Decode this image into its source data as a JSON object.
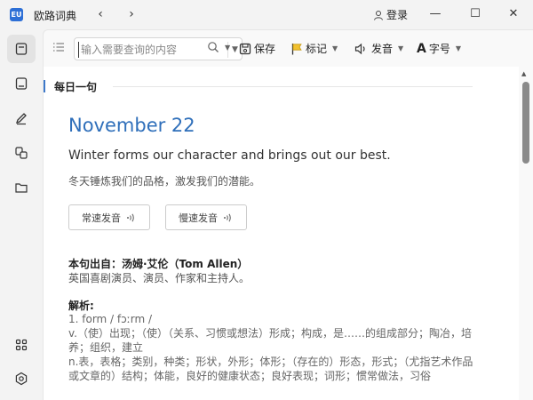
{
  "app": {
    "title": "欧路词典",
    "login": "登录"
  },
  "toolbar": {
    "search_placeholder": "输入需要查询的内容",
    "save": "保存",
    "mark": "标记",
    "speak": "发音",
    "fontsize": "字号"
  },
  "sidebar": {
    "items": [
      {
        "icon": "dictionary-icon",
        "active": true
      },
      {
        "icon": "book-icon"
      },
      {
        "icon": "pen-icon"
      },
      {
        "icon": "translate-icon"
      },
      {
        "icon": "folder-icon"
      },
      {
        "icon": "apps-icon"
      },
      {
        "icon": "settings-icon"
      }
    ]
  },
  "daily": {
    "section_title": "每日一句",
    "date": "November 22",
    "sentence_en": "Winter forms our character and brings out our best.",
    "sentence_zh": "冬天锤炼我们的品格，激发我们的潜能。",
    "btn_normal": "常速发音",
    "btn_slow": "慢速发音",
    "source_label": "本句出自：汤姆·艾伦（Tom Allen）",
    "source_desc": "英国喜剧演员、演员、作家和主持人。",
    "analysis_label": "解析:",
    "analysis_lines": [
      "1. form / fɔːrm /",
      "v.（使）出现；（使）（关系、习惯或想法）形成；构成，是……的组成部分；陶冶，培",
      "养；组织，建立",
      "n.表，表格；类别，种类；形状，外形；体形；（存在的）形态，形式；（尤指艺术作品",
      "或文章的）结构；体能，良好的健康状态；良好表现；词形；惯常做法，习俗"
    ]
  }
}
